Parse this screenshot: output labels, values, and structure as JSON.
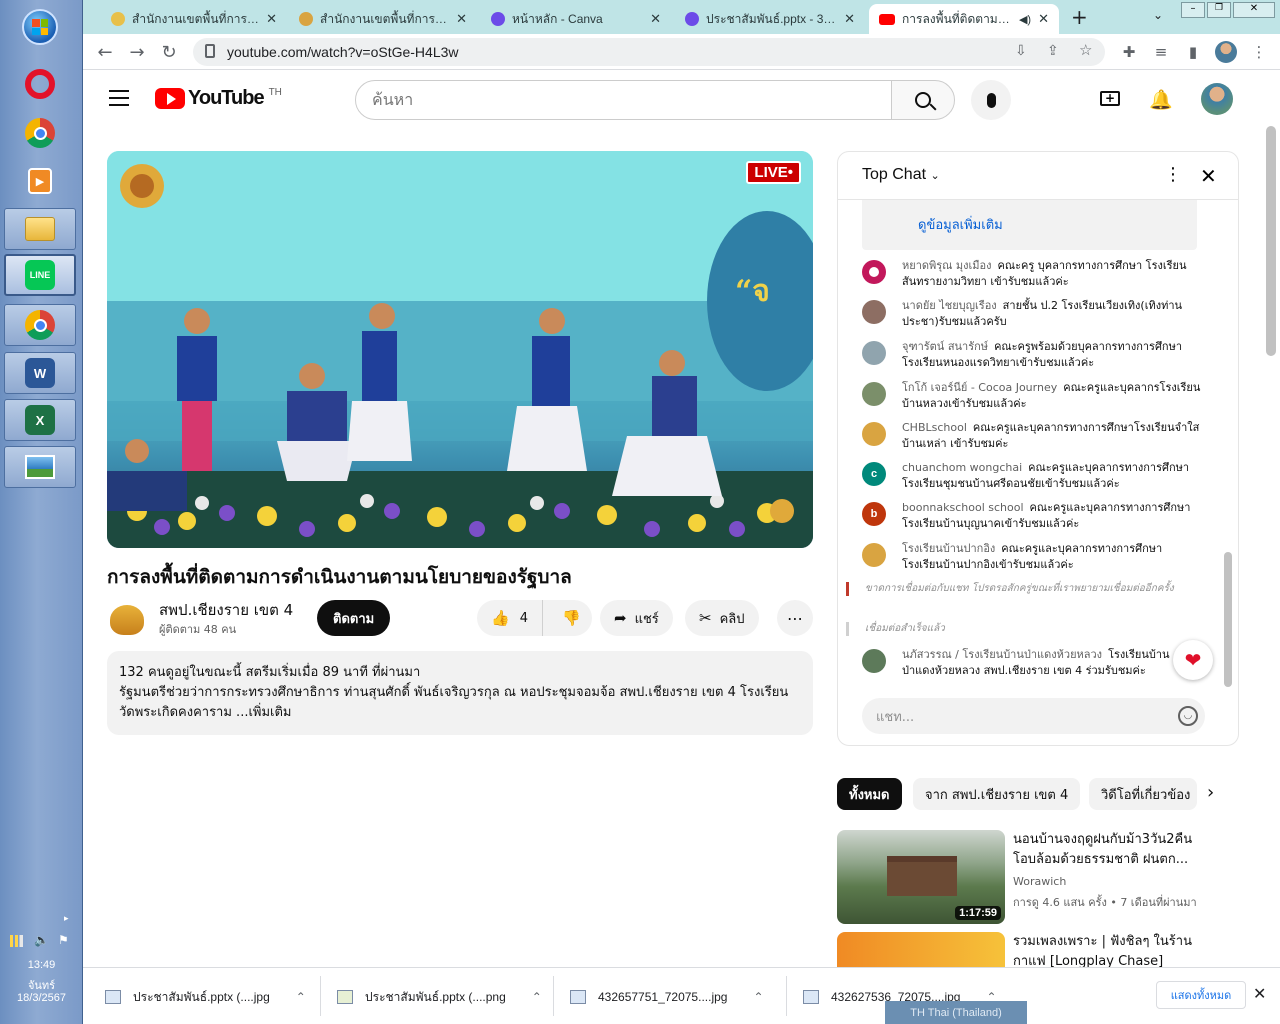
{
  "taskbar": {
    "apps": [
      {
        "name": "windows-start",
        "label": ""
      },
      {
        "name": "opera",
        "label": "O"
      },
      {
        "name": "chrome",
        "label": ""
      },
      {
        "name": "media-player",
        "label": ""
      },
      {
        "name": "file-explorer",
        "label": ""
      },
      {
        "name": "line",
        "label": "LINE"
      },
      {
        "name": "chrome-profile",
        "label": ""
      },
      {
        "name": "word",
        "label": "W"
      },
      {
        "name": "excel",
        "label": "X"
      },
      {
        "name": "photo-viewer",
        "label": ""
      }
    ],
    "tray": {
      "time": "13:49",
      "day": "จันทร์",
      "date": "18/3/2567"
    }
  },
  "browser": {
    "tabs": [
      {
        "title": "สำนักงานเขตพื้นที่การศึกษา",
        "favicon": "#e8c04a"
      },
      {
        "title": "สำนักงานเขตพื้นที่การศึกษา",
        "favicon": "#d9a441"
      },
      {
        "title": "หน้าหลัก - Canva",
        "favicon": "#6c4be8"
      },
      {
        "title": "ประชาสัมพันธ์.pptx - 3779",
        "favicon": "#6c4be8"
      },
      {
        "title": "การลงพื้นที่ติดตามการดำเนินงาน",
        "favicon": "#ff0000"
      }
    ],
    "new_tab": "+",
    "url": "youtube.com/watch?v=oStGe-H4L3w",
    "accent": "#bfe4e6"
  },
  "youtube": {
    "logo": "YouTube",
    "country": "TH",
    "search_placeholder": "ค้นหา",
    "video": {
      "live_badge": "LIVE•",
      "title": "การลงพื้นที่ติดตามการดำเนินงานตามนโยบายของรัฐบาล",
      "channel": "สพป.เชียงราย เขต 4",
      "subscribers": "ผู้ติดตาม 48 คน",
      "subscribe_label": "ติดตาม",
      "likes": "4",
      "share_label": "แชร์",
      "clip_label": "คลิป",
      "description_stats": "132 คนดูอยู่ในขณะนี้  สตรีมเริ่มเมื่อ 89 นาที ที่ผ่านมา",
      "description_text": "รัฐมนตรีช่วยว่าการกระทรวงศึกษาธิการ ท่านสุนศักดิ์ พันธ์เจริญวรกุล ณ หอประชุมจอมจ้อ สพป.เชียงราย เขต 4 โรงเรียนวัดพระเกิดคงคาราม ...",
      "description_more": "เพิ่มเติม"
    },
    "chat": {
      "mode": "Top Chat",
      "banner_link": "ดูข้อมูลเพิ่มเติม",
      "messages": [
        {
          "author": "หยาดพิรุณ มุงเมือง",
          "text": "คณะครู บุคลากรทางการศึกษา โรงเรียนสันทรายงามวิทยา เข้ารับชมแล้วค่ะ",
          "color": "#c2185b",
          "initial": ""
        },
        {
          "author": "นาดยัย ไชยบุญเรือง",
          "text": "สายชั้น ป.2 โรงเรียนเวียงเทิง(เทิงท่านประชา)รับชมแล้วครับ",
          "color": "#8d6e63",
          "initial": ""
        },
        {
          "author": "จุฑารัตน์ สนารักษ์",
          "text": "คณะครูพร้อมด้วยบุคลากรทางการศึกษาโรงเรียนหนองแรดวิทยาเข้ารับชมแล้วค่ะ",
          "color": "#90a4ae",
          "initial": ""
        },
        {
          "author": "โกโก้ เจอร์นีย์ - Cocoa Journey",
          "text": "คณะครูและบุคลากรโรงเรียนบ้านหลวงเข้ารับชมแล้วค่ะ",
          "color": "#7b8f6a",
          "initial": ""
        },
        {
          "author": "CHBLschool",
          "text": "คณะครูและบุคลากรทางการศึกษาโรงเรียนจำใสบ้านเหล่า เข้ารับชมค่ะ",
          "color": "#d9a441",
          "initial": ""
        },
        {
          "author": "chuanchom wongchai",
          "text": "คณะครูและบุคลากรทางการศึกษาโรงเรียนชุมชนบ้านศรีดอนชัยเข้ารับชมแล้วค่ะ",
          "color": "#00897b",
          "initial": "c"
        },
        {
          "author": "boonnakschool school",
          "text": "คณะครูและบุคลากรทางการศึกษาโรงเรียนบ้านบุญนาคเข้ารับชมแล้วค่ะ",
          "color": "#bf360c",
          "initial": "b"
        },
        {
          "author": "โรงเรียนบ้านปากอิง",
          "text": "คณะครูและบุคลากรทางการศึกษาโรงเรียนบ้านปากอิงเข้ารับชมแล้วค่ะ",
          "color": "#d9a441",
          "initial": ""
        }
      ],
      "system_reconnecting": "ขาดการเชื่อมต่อกับแชท โปรดรอสักครู่ขณะที่เราพยายามเชื่อมต่ออีกครั้ง",
      "system_connected": "เชื่อมต่อสำเร็จแล้ว",
      "last_message": {
        "author": "นภัสวรรณ / โรงเรียนบ้านป่าแดงห้วยหลวง",
        "text": "โรงเรียนบ้านป่าแดงห้วยหลวง สพป.เชียงราย เขต 4 ร่วมรับชมค่ะ",
        "color": "#5d7a5a"
      },
      "input_placeholder": "แชท...",
      "heart": "❤"
    },
    "chips": [
      "ทั้งหมด",
      "จาก สพป.เชียงราย เขต 4",
      "วิดีโอที่เกี่ยวข้อง"
    ],
    "recommendations": [
      {
        "title": "นอนบ้านจงฤดูฝนกับม้า3วัน2คืน โอบล้อมด้วยธรรมชาติ ฝนตก...",
        "channel": "Worawich",
        "meta": "การดู 4.6 แสน ครั้ง  • 7 เดือนที่ผ่านมา",
        "duration": "1:17:59"
      },
      {
        "title": "รวมเพลงเพราะ | ฟังชิลๆ ในร้านกาแฟ [Longplay Chase]",
        "channel": "",
        "meta": "",
        "duration": ""
      }
    ]
  },
  "downloads": {
    "items": [
      "ประชาสัมพันธ์.pptx (....jpg",
      "ประชาสัมพันธ์.pptx (....png",
      "432657751_72075....jpg",
      "432627536_72075....jpg"
    ],
    "show_all": "แสดงทั้งหมด"
  },
  "ime": "TH Thai (Thailand)"
}
